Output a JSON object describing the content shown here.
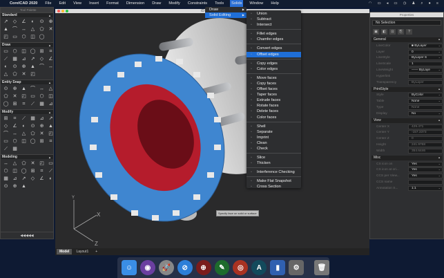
{
  "menubar": {
    "app": "CorelCAD 2020",
    "items": [
      "File",
      "Edit",
      "View",
      "Insert",
      "Format",
      "Dimension",
      "Draw",
      "Modify",
      "Constraints",
      "Tools",
      "Solids",
      "Window",
      "Help"
    ],
    "active": "Solids"
  },
  "palette": {
    "title": "Tool Palette",
    "sections": [
      {
        "name": "Standard",
        "count": 17
      },
      {
        "name": "Draw",
        "count": 22
      },
      {
        "name": "Entity Snap",
        "count": 18
      },
      {
        "name": "Modify",
        "count": 26
      },
      {
        "name": "Modeling",
        "count": 21
      }
    ],
    "footer": "◀◀◀◀◀"
  },
  "window": {
    "title": "/D"
  },
  "solids_menu": {
    "items": [
      {
        "label": "Draw"
      },
      {
        "label": "Solid Editing",
        "highlighted": true
      }
    ]
  },
  "submenu": {
    "groups": [
      [
        "Union",
        "Subtract",
        "Intersect"
      ],
      [
        "Fillet edges",
        "Chamfer edges"
      ],
      [
        "Convert edges",
        "Offset edges"
      ],
      [
        "Copy edges",
        "Color edges"
      ],
      [
        "Move faces",
        "Copy faces",
        "Offset faces",
        "Taper faces",
        "Extrude faces",
        "Rotate faces",
        "Delete faces",
        "Color faces"
      ],
      [
        "Shell",
        "Separate",
        "Imprint",
        "Clean",
        "Check"
      ],
      [
        "Slice",
        "Thicken"
      ],
      [
        "Interference Checking"
      ],
      [
        "Make Flat Snapshot",
        "Cross Section"
      ]
    ],
    "highlighted": "Offset edges"
  },
  "tooltip": "Specify face on solid or surface",
  "tabs": [
    "Model",
    "Layout1",
    "+"
  ],
  "properties": {
    "title": "Properties",
    "selection": "No Selection",
    "sections": [
      {
        "name": "General",
        "rows": [
          {
            "k": "LineColor",
            "v": "■ ByLayer",
            "dd": true
          },
          {
            "k": "Layer",
            "v": "0",
            "dd": true
          },
          {
            "k": "LineStyle",
            "v": "ByLayer   S",
            "dd": true
          },
          {
            "k": "LineScale",
            "v": "1"
          },
          {
            "k": "LineWeight",
            "v": "—— ByLaye",
            "dd": true
          },
          {
            "k": "Hyperlink",
            "v": ""
          },
          {
            "k": "Transparency",
            "v": "ByLayer",
            "ro": true
          }
        ]
      },
      {
        "name": "PrintStyle",
        "rows": [
          {
            "k": "Style",
            "v": "ByColor",
            "dd": true
          },
          {
            "k": "Table",
            "v": "None",
            "dd": true
          },
          {
            "k": "Type",
            "v": "None",
            "ro": true
          },
          {
            "k": "Display",
            "v": "No",
            "dd": true
          }
        ]
      },
      {
        "name": "View",
        "rows": [
          {
            "k": "Center X",
            "v": "429.471",
            "ro": true
          },
          {
            "k": "Center Y",
            "v": "-157.3373",
            "ro": true
          },
          {
            "k": "Center Z",
            "v": "0",
            "ro": true
          },
          {
            "k": "Height",
            "v": "241.9768",
            "ro": true
          },
          {
            "k": "Width",
            "v": "354.6446",
            "ro": true
          }
        ]
      },
      {
        "name": "Misc",
        "rows": [
          {
            "k": "CS icon on",
            "v": "Yes",
            "dd": true
          },
          {
            "k": "CS icon at ori...",
            "v": "Yes",
            "dd": true
          },
          {
            "k": "CCS per View...",
            "v": "Yes",
            "dd": true
          },
          {
            "k": "CCS name",
            "v": ""
          },
          {
            "k": "Annotation S...",
            "v": "1:1",
            "dd": true
          }
        ]
      }
    ]
  },
  "axes": {
    "x": "X",
    "y": "Y",
    "z": "Z"
  },
  "colors": {
    "accent": "#1f6fd8",
    "flange": "#3f86d0",
    "inner": "#c8102e"
  },
  "dock": [
    {
      "icon": "finder-icon",
      "c": "#3a8ee6",
      "g": "☺"
    },
    {
      "icon": "siri-icon",
      "c": "#6b3fa0",
      "g": "◉"
    },
    {
      "icon": "launchpad-icon",
      "c": "#888",
      "g": "🚀"
    },
    {
      "icon": "safari-icon",
      "c": "#2d7fd8",
      "g": "⊘"
    },
    {
      "icon": "corelcad-icon",
      "c": "#7a1c1c",
      "g": "⊕"
    },
    {
      "icon": "pen-icon",
      "c": "#1e6b2c",
      "g": "✎"
    },
    {
      "icon": "camera-icon",
      "c": "#a83222",
      "g": "◎"
    },
    {
      "icon": "a-icon",
      "c": "#134a5c",
      "g": "A"
    },
    {
      "icon": "parallels-icon",
      "c": "#3060b0",
      "g": "▮"
    },
    {
      "icon": "settings-icon",
      "c": "#666",
      "g": "⚙"
    },
    {
      "icon": "trash-icon",
      "c": "#777",
      "g": "🗑"
    }
  ]
}
